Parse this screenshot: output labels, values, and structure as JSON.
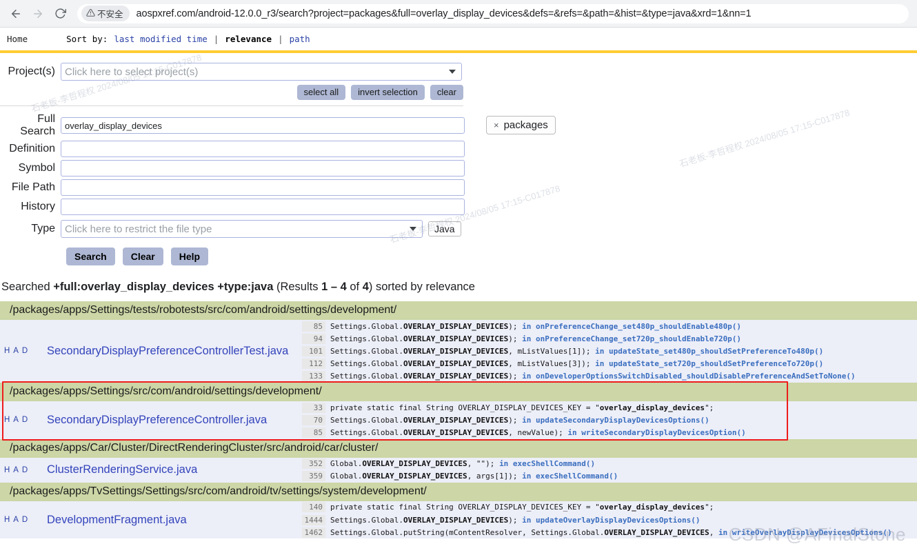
{
  "browser": {
    "back_icon": "arrow-left-icon",
    "forward_icon": "arrow-right-icon",
    "reload_icon": "reload-icon",
    "security_label": "不安全",
    "security_icon": "warning-triangle-icon",
    "url": "aospxref.com/android-12.0.0_r3/search?project=packages&full=overlay_display_devices&defs=&refs=&path=&hist=&type=java&xrd=1&nn=1"
  },
  "menubar": {
    "home": "Home",
    "sort_label": "Sort by:",
    "options": [
      {
        "label": "last modified time",
        "active": false
      },
      {
        "label": "relevance",
        "active": true
      },
      {
        "label": "path",
        "active": false
      }
    ],
    "separator": "|"
  },
  "form": {
    "project_label": "Project(s)",
    "project_placeholder": "Click here to select project(s)",
    "select_all": "select all",
    "invert_selection": "invert selection",
    "clear_small": "clear",
    "fields": [
      {
        "label": "Full Search",
        "value": "overlay_display_devices",
        "placeholder": ""
      },
      {
        "label": "Definition",
        "value": "",
        "placeholder": ""
      },
      {
        "label": "Symbol",
        "value": "",
        "placeholder": ""
      },
      {
        "label": "File Path",
        "value": "",
        "placeholder": ""
      },
      {
        "label": "History",
        "value": "",
        "placeholder": ""
      }
    ],
    "type_label": "Type",
    "type_placeholder": "Click here to restrict the file type",
    "type_chip": "Java",
    "search_button": "Search",
    "clear_button": "Clear",
    "help_button": "Help",
    "selected_project_chip": "packages",
    "chip_remove": "×"
  },
  "summary": {
    "prefix": "Searched ",
    "query": "+full:overlay_display_devices +type:java",
    "results_open": " (Results ",
    "range": "1 – 4",
    "of": " of ",
    "total": "4",
    "results_close": ") sorted by relevance"
  },
  "results": [
    {
      "directory": "/packages/apps/Settings/tests/robotests/src/com/android/settings/development/",
      "flags": "H A D",
      "filename": "SecondaryDisplayPreferenceControllerTest.java",
      "highlighted": false,
      "snippets": [
        {
          "line": "85",
          "pre": "Settings.Global.",
          "sym": "OVERLAY_DISPLAY_DEVICES",
          "post": ");",
          "in": "in onPreferenceChange_set480p_shouldEnable480p()"
        },
        {
          "line": "94",
          "pre": "Settings.Global.",
          "sym": "OVERLAY_DISPLAY_DEVICES",
          "post": ");",
          "in": "in onPreferenceChange_set720p_shouldEnable720p()"
        },
        {
          "line": "101",
          "pre": "Settings.Global.",
          "sym": "OVERLAY_DISPLAY_DEVICES",
          "post": ", mListValues[1]);",
          "in": "in updateState_set480p_shouldSetPreferenceTo480p()"
        },
        {
          "line": "112",
          "pre": "Settings.Global.",
          "sym": "OVERLAY_DISPLAY_DEVICES",
          "post": ", mListValues[3]);",
          "in": "in updateState_set720p_shouldSetPreferenceTo720p()"
        },
        {
          "line": "133",
          "pre": "Settings.Global.",
          "sym": "OVERLAY_DISPLAY_DEVICES",
          "post": ");",
          "in": "in onDeveloperOptionsSwitchDisabled_shouldDisablePreferenceAndSetToNone()"
        }
      ]
    },
    {
      "directory": "/packages/apps/Settings/src/com/android/settings/development/",
      "flags": "H A D",
      "filename": "SecondaryDisplayPreferenceController.java",
      "highlighted": true,
      "snippets": [
        {
          "line": "33",
          "pre": "private static final String OVERLAY_DISPLAY_DEVICES_KEY = \"",
          "sym": "overlay_display_devices",
          "post": "\";",
          "in": ""
        },
        {
          "line": "70",
          "pre": "Settings.Global.",
          "sym": "OVERLAY_DISPLAY_DEVICES",
          "post": ");",
          "in": "in updateSecondaryDisplayDevicesOptions()"
        },
        {
          "line": "85",
          "pre": "Settings.Global.",
          "sym": "OVERLAY_DISPLAY_DEVICES",
          "post": ", newValue);",
          "in": "in writeSecondaryDisplayDevicesOption()"
        }
      ]
    },
    {
      "directory": "/packages/apps/Car/Cluster/DirectRenderingCluster/src/android/car/cluster/",
      "flags": "H A D",
      "filename": "ClusterRenderingService.java",
      "highlighted": false,
      "snippets": [
        {
          "line": "352",
          "pre": "Global.",
          "sym": "OVERLAY_DISPLAY_DEVICES",
          "post": ", \"\");",
          "in": "in execShellCommand()"
        },
        {
          "line": "359",
          "pre": "Global.",
          "sym": "OVERLAY_DISPLAY_DEVICES",
          "post": ", args[1]);",
          "in": "in execShellCommand()"
        }
      ]
    },
    {
      "directory": "/packages/apps/TvSettings/Settings/src/com/android/tv/settings/system/development/",
      "flags": "H A D",
      "filename": "DevelopmentFragment.java",
      "highlighted": false,
      "snippets": [
        {
          "line": "140",
          "pre": "private static final String OVERLAY_DISPLAY_DEVICES_KEY = \"",
          "sym": "overlay_display_devices",
          "post": "\";",
          "in": ""
        },
        {
          "line": "1444",
          "pre": "Settings.Global.",
          "sym": "OVERLAY_DISPLAY_DEVICES",
          "post": ");",
          "in": "in updateOverlayDisplayDevicesOptions()"
        },
        {
          "line": "1462",
          "pre": "Settings.Global.putString(mContentResolver, Settings.Global.",
          "sym": "OVERLAY_DISPLAY_DEVICES",
          "post": ",",
          "in": "in writeOverlayDisplayDevicesOptions()"
        }
      ]
    }
  ],
  "watermark": {
    "csdn": "CSDN @AFinalStone",
    "tiles": [
      "石老板-李哲程权 2024/08/05 17:15-C017878",
      "石老板-李哲程权 2024/08/05 17:15-C017878",
      "石老板-李哲程权 2024/08/05 17:15-C017878"
    ]
  },
  "colors": {
    "accent_yellow": "#ffcc33",
    "dir_header_green": "#ccd6a6",
    "row_lavender": "#eceef8",
    "link_blue": "#3344bb",
    "highlight_red": "#ee1c1c"
  }
}
